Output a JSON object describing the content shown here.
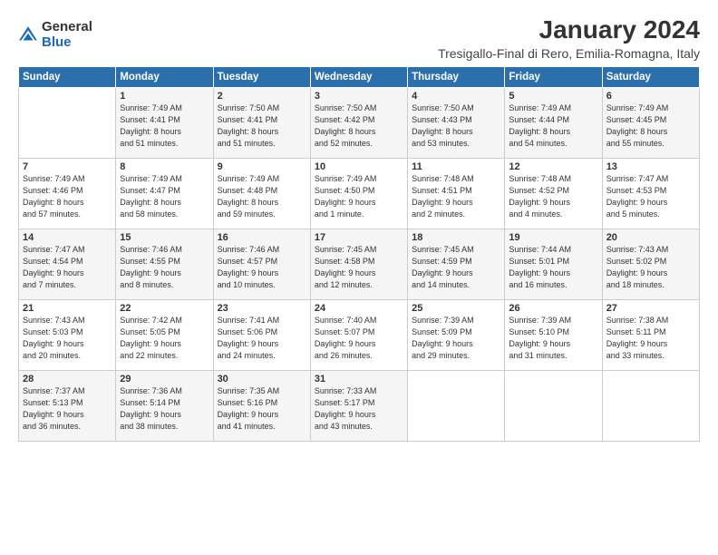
{
  "logo": {
    "general": "General",
    "blue": "Blue"
  },
  "header": {
    "month": "January 2024",
    "location": "Tresigallo-Final di Rero, Emilia-Romagna, Italy"
  },
  "columns": [
    "Sunday",
    "Monday",
    "Tuesday",
    "Wednesday",
    "Thursday",
    "Friday",
    "Saturday"
  ],
  "weeks": [
    [
      {
        "day": "",
        "info": ""
      },
      {
        "day": "1",
        "info": "Sunrise: 7:49 AM\nSunset: 4:41 PM\nDaylight: 8 hours\nand 51 minutes."
      },
      {
        "day": "2",
        "info": "Sunrise: 7:50 AM\nSunset: 4:41 PM\nDaylight: 8 hours\nand 51 minutes."
      },
      {
        "day": "3",
        "info": "Sunrise: 7:50 AM\nSunset: 4:42 PM\nDaylight: 8 hours\nand 52 minutes."
      },
      {
        "day": "4",
        "info": "Sunrise: 7:50 AM\nSunset: 4:43 PM\nDaylight: 8 hours\nand 53 minutes."
      },
      {
        "day": "5",
        "info": "Sunrise: 7:49 AM\nSunset: 4:44 PM\nDaylight: 8 hours\nand 54 minutes."
      },
      {
        "day": "6",
        "info": "Sunrise: 7:49 AM\nSunset: 4:45 PM\nDaylight: 8 hours\nand 55 minutes."
      }
    ],
    [
      {
        "day": "7",
        "info": "Sunrise: 7:49 AM\nSunset: 4:46 PM\nDaylight: 8 hours\nand 57 minutes."
      },
      {
        "day": "8",
        "info": "Sunrise: 7:49 AM\nSunset: 4:47 PM\nDaylight: 8 hours\nand 58 minutes."
      },
      {
        "day": "9",
        "info": "Sunrise: 7:49 AM\nSunset: 4:48 PM\nDaylight: 8 hours\nand 59 minutes."
      },
      {
        "day": "10",
        "info": "Sunrise: 7:49 AM\nSunset: 4:50 PM\nDaylight: 9 hours\nand 1 minute."
      },
      {
        "day": "11",
        "info": "Sunrise: 7:48 AM\nSunset: 4:51 PM\nDaylight: 9 hours\nand 2 minutes."
      },
      {
        "day": "12",
        "info": "Sunrise: 7:48 AM\nSunset: 4:52 PM\nDaylight: 9 hours\nand 4 minutes."
      },
      {
        "day": "13",
        "info": "Sunrise: 7:47 AM\nSunset: 4:53 PM\nDaylight: 9 hours\nand 5 minutes."
      }
    ],
    [
      {
        "day": "14",
        "info": "Sunrise: 7:47 AM\nSunset: 4:54 PM\nDaylight: 9 hours\nand 7 minutes."
      },
      {
        "day": "15",
        "info": "Sunrise: 7:46 AM\nSunset: 4:55 PM\nDaylight: 9 hours\nand 8 minutes."
      },
      {
        "day": "16",
        "info": "Sunrise: 7:46 AM\nSunset: 4:57 PM\nDaylight: 9 hours\nand 10 minutes."
      },
      {
        "day": "17",
        "info": "Sunrise: 7:45 AM\nSunset: 4:58 PM\nDaylight: 9 hours\nand 12 minutes."
      },
      {
        "day": "18",
        "info": "Sunrise: 7:45 AM\nSunset: 4:59 PM\nDaylight: 9 hours\nand 14 minutes."
      },
      {
        "day": "19",
        "info": "Sunrise: 7:44 AM\nSunset: 5:01 PM\nDaylight: 9 hours\nand 16 minutes."
      },
      {
        "day": "20",
        "info": "Sunrise: 7:43 AM\nSunset: 5:02 PM\nDaylight: 9 hours\nand 18 minutes."
      }
    ],
    [
      {
        "day": "21",
        "info": "Sunrise: 7:43 AM\nSunset: 5:03 PM\nDaylight: 9 hours\nand 20 minutes."
      },
      {
        "day": "22",
        "info": "Sunrise: 7:42 AM\nSunset: 5:05 PM\nDaylight: 9 hours\nand 22 minutes."
      },
      {
        "day": "23",
        "info": "Sunrise: 7:41 AM\nSunset: 5:06 PM\nDaylight: 9 hours\nand 24 minutes."
      },
      {
        "day": "24",
        "info": "Sunrise: 7:40 AM\nSunset: 5:07 PM\nDaylight: 9 hours\nand 26 minutes."
      },
      {
        "day": "25",
        "info": "Sunrise: 7:39 AM\nSunset: 5:09 PM\nDaylight: 9 hours\nand 29 minutes."
      },
      {
        "day": "26",
        "info": "Sunrise: 7:39 AM\nSunset: 5:10 PM\nDaylight: 9 hours\nand 31 minutes."
      },
      {
        "day": "27",
        "info": "Sunrise: 7:38 AM\nSunset: 5:11 PM\nDaylight: 9 hours\nand 33 minutes."
      }
    ],
    [
      {
        "day": "28",
        "info": "Sunrise: 7:37 AM\nSunset: 5:13 PM\nDaylight: 9 hours\nand 36 minutes."
      },
      {
        "day": "29",
        "info": "Sunrise: 7:36 AM\nSunset: 5:14 PM\nDaylight: 9 hours\nand 38 minutes."
      },
      {
        "day": "30",
        "info": "Sunrise: 7:35 AM\nSunset: 5:16 PM\nDaylight: 9 hours\nand 41 minutes."
      },
      {
        "day": "31",
        "info": "Sunrise: 7:33 AM\nSunset: 5:17 PM\nDaylight: 9 hours\nand 43 minutes."
      },
      {
        "day": "",
        "info": ""
      },
      {
        "day": "",
        "info": ""
      },
      {
        "day": "",
        "info": ""
      }
    ]
  ]
}
